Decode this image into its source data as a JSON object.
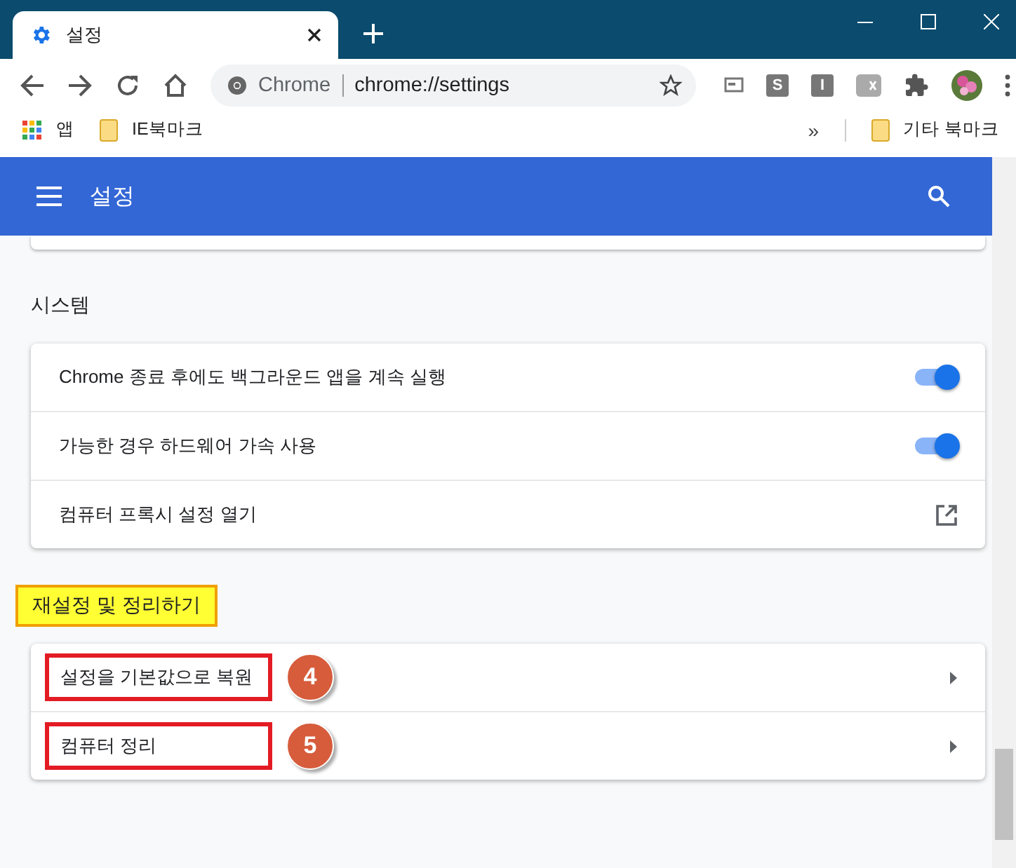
{
  "tab": {
    "title": "설정"
  },
  "address_bar": {
    "origin_label": "Chrome",
    "url": "chrome://settings"
  },
  "extensions": [
    {
      "kind": "screen"
    },
    {
      "kind": "letter",
      "label": "S"
    },
    {
      "kind": "letter",
      "label": "I"
    },
    {
      "kind": "ex"
    },
    {
      "kind": "puzzle"
    },
    {
      "kind": "avatar"
    }
  ],
  "bookmarks": [
    {
      "kind": "apps",
      "label": "앱"
    },
    {
      "kind": "folder",
      "label": "IE북마크"
    }
  ],
  "bookmarks_right": {
    "overflow": "»",
    "label": "기타 북마크"
  },
  "header": {
    "title": "설정"
  },
  "sections": [
    {
      "title": "시스템",
      "highlighted": false,
      "rows": [
        {
          "kind": "toggle",
          "label": "Chrome 종료 후에도 백그라운드 앱을 계속 실행",
          "on": true
        },
        {
          "kind": "toggle",
          "label": "가능한 경우 하드웨어 가속 사용",
          "on": true
        },
        {
          "kind": "external",
          "label": "컴퓨터 프록시 설정 열기"
        }
      ]
    },
    {
      "title": "재설정 및 정리하기",
      "highlighted": true,
      "rows": [
        {
          "kind": "arrow",
          "label": "설정을 기본값으로 복원",
          "callout": "4"
        },
        {
          "kind": "arrow",
          "label": "컴퓨터 정리",
          "callout": "5"
        }
      ]
    }
  ]
}
